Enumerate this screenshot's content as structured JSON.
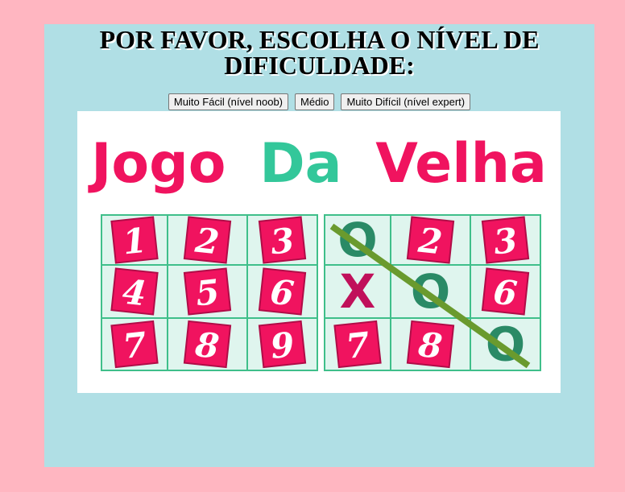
{
  "heading": "POR FAVOR, ESCOLHA O NÍVEL DE DIFICULDADE:",
  "buttons": [
    {
      "label": "Muito Fácil (nível noob)"
    },
    {
      "label": "Médio"
    },
    {
      "label": "Muito Difícil (nível expert)"
    }
  ],
  "banner": {
    "title_part1": "Jogo",
    "title_part2": "Da",
    "title_part3": "Velha",
    "colors": {
      "pink": "#f0135f",
      "green": "#33c79a",
      "cell_bg": "#dff5ee",
      "grid": "#3fbf8a",
      "win_line": "#6a9a2e",
      "mark_o": "#2a8a66",
      "mark_x": "#c0105a"
    },
    "left_board": [
      "1",
      "2",
      "3",
      "4",
      "5",
      "6",
      "7",
      "8",
      "9"
    ],
    "right_board": [
      "O",
      "2",
      "3",
      "X",
      "O",
      "6",
      "7",
      "8",
      "O"
    ]
  }
}
